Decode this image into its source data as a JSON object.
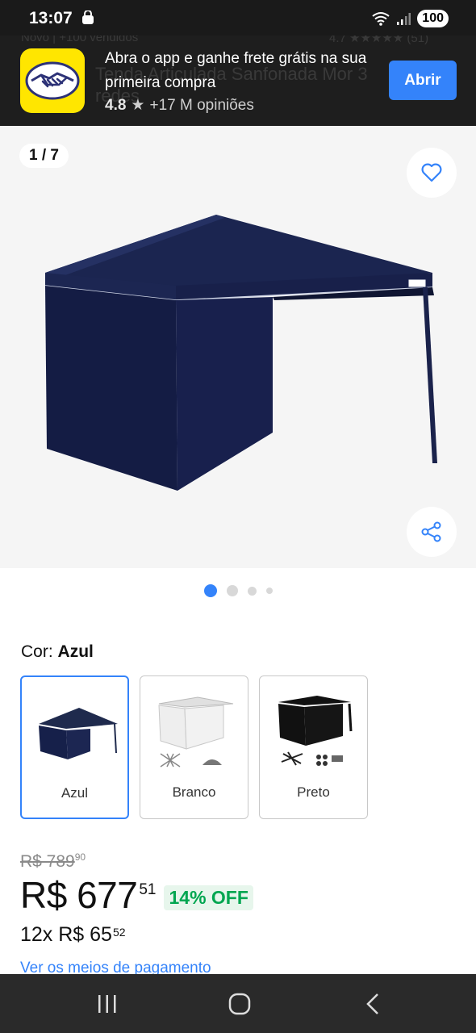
{
  "status_bar": {
    "time": "13:07",
    "battery": "100"
  },
  "banner": {
    "title": "Abra o app e ganhe frete grátis na sua primeira compra",
    "rating_score": "4.8",
    "opinions": "+17 M opiniões",
    "open_label": "Abrir",
    "ghost_left": "Novo | +100 vendidos",
    "ghost_right": "4.7 ★★★★★ (51)",
    "ghost_title": "Tenda Articulada Sanfonada Mor 3",
    "ghost_title2": "redes",
    "accent": "#3483fa",
    "logo_bg": "#ffe600"
  },
  "gallery": {
    "counter": "1 / 7",
    "current_index": 1,
    "visible_dots": 4
  },
  "color_selector": {
    "label": "Cor:",
    "selected": "Azul",
    "options": [
      {
        "name": "Azul",
        "color": "#1f2a4d",
        "selected": true
      },
      {
        "name": "Branco",
        "color": "#e8e8e8",
        "selected": false
      },
      {
        "name": "Preto",
        "color": "#111111",
        "selected": false
      }
    ]
  },
  "pricing": {
    "old_price": "R$ 789",
    "old_cents": "90",
    "price": "R$ 677",
    "price_cents": "51",
    "discount": "14% OFF",
    "installments": "12x R$ 65",
    "installment_cents": "52",
    "payment_link": "Ver os meios de pagamento",
    "discount_color": "#00a650"
  }
}
